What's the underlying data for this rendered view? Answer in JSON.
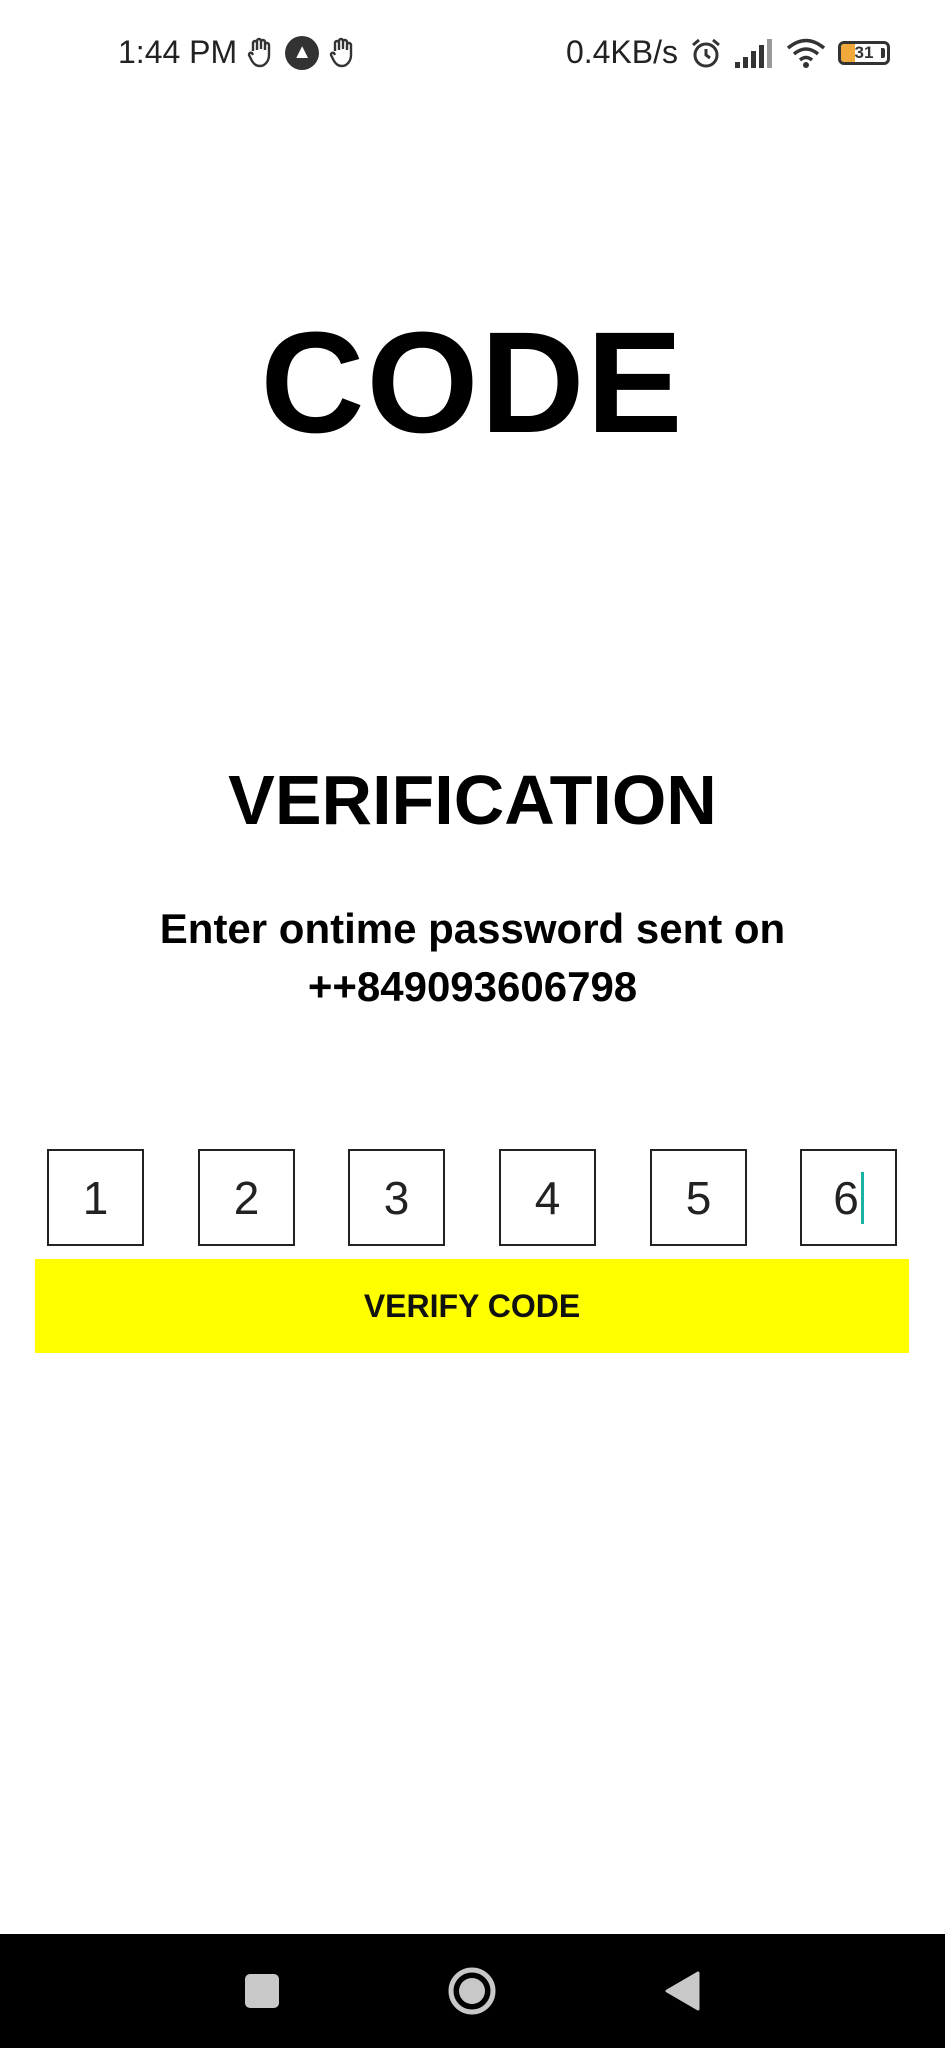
{
  "status_bar": {
    "time": "1:44 PM",
    "network_speed": "0.4KB/s",
    "battery_level": "31",
    "icons_left": [
      "hand-gesture-icon",
      "app-a-icon",
      "hand-gesture-icon"
    ],
    "icons_right": [
      "alarm-icon",
      "signal-icon",
      "wifi-icon",
      "battery-icon"
    ]
  },
  "main": {
    "title": "CODE",
    "subtitle": "VERIFICATION",
    "instruction_line1": "Enter ontime password sent on",
    "instruction_line2": "++849093606798",
    "otp_digits": [
      "1",
      "2",
      "3",
      "4",
      "5",
      "6"
    ],
    "focused_index": 5,
    "verify_button_label": "VERIFY CODE"
  },
  "colors": {
    "button_bg": "#ffff00",
    "cursor": "#17b4a4",
    "nav_bar_bg": "#000000"
  },
  "nav_bar": {
    "buttons": [
      "recents-square-icon",
      "home-circle-icon",
      "back-triangle-icon"
    ]
  }
}
